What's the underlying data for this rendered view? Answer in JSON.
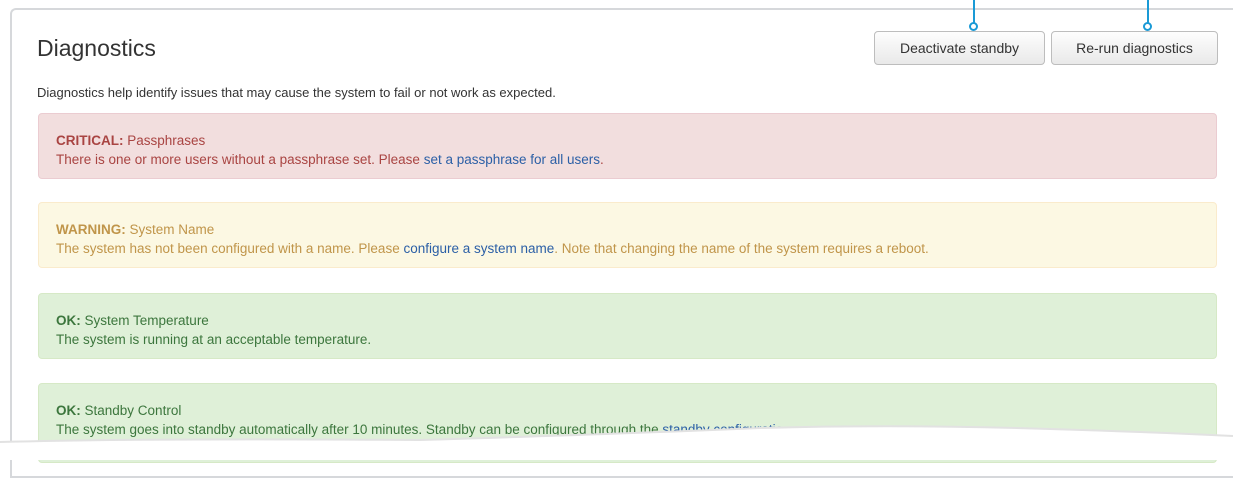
{
  "page": {
    "title": "Diagnostics",
    "description": "Diagnostics help identify issues that may cause the system to fail or not work as expected."
  },
  "toolbar": {
    "deactivate_label": "Deactivate standby",
    "rerun_label": "Re-run diagnostics"
  },
  "alerts": [
    {
      "severity": "CRITICAL:",
      "name": "Passphrases",
      "text_before": "There is one or more users without a passphrase set. Please ",
      "link": "set a passphrase for all users",
      "text_after": "."
    },
    {
      "severity": "WARNING:",
      "name": "System Name",
      "text_before": "The system has not been configured with a name. Please ",
      "link": "configure a system name",
      "text_after": ". Note that changing the name of the system requires a reboot."
    },
    {
      "severity": "OK:",
      "name": "System Temperature",
      "text_before": "The system is running at an acceptable temperature.",
      "link": "",
      "text_after": ""
    },
    {
      "severity": "OK:",
      "name": "Standby Control",
      "text_before": "The system goes into standby automatically after 10 minutes. Standby can be configured through the ",
      "link": "standby configuration",
      "text_after": "."
    }
  ],
  "colors": {
    "callout": "#1a9ad6",
    "critical_bg": "#f2dede",
    "warning_bg": "#fcf8e3",
    "ok_bg": "#dff0d8",
    "link": "#2b5fa6"
  }
}
